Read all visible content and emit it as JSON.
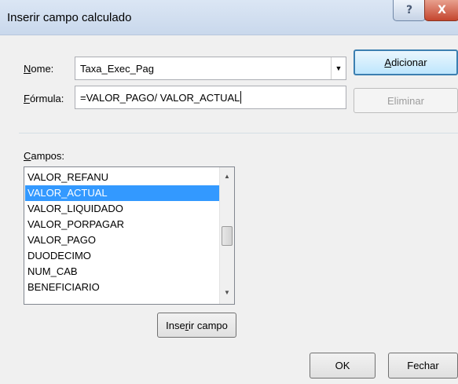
{
  "window": {
    "title": "Inserir campo calculado",
    "help_glyph": "?",
    "close_glyph": "X"
  },
  "name_field": {
    "label_underline": "N",
    "label_rest": "ome:",
    "value": "Taxa_Exec_Pag"
  },
  "formula_field": {
    "label_underline": "F",
    "label_rest": "órmula:",
    "value": "=VALOR_PAGO/ VALOR_ACTUAL"
  },
  "buttons": {
    "add_underline": "A",
    "add_rest": "dicionar",
    "delete": "Eliminar",
    "insert_pre": "Inse",
    "insert_underline": "r",
    "insert_post": "ir campo",
    "ok": "OK",
    "close": "Fechar"
  },
  "fields_list": {
    "label_underline": "C",
    "label_rest": "ampos:",
    "items": [
      "VALOR_REFANU",
      "VALOR_ACTUAL",
      "VALOR_LIQUIDADO",
      "VALOR_PORPAGAR",
      "VALOR_PAGO",
      "DUODECIMO",
      "NUM_CAB",
      "BENEFICIARIO"
    ],
    "selected_index": 1
  },
  "icons": {
    "combo_dropdown": "chevron-down-icon",
    "scroll_up": "scroll-up-arrow-icon",
    "scroll_down": "scroll-down-arrow-icon"
  },
  "colors": {
    "selection": "#3399ff",
    "default_button_border": "#3c7fb1"
  }
}
